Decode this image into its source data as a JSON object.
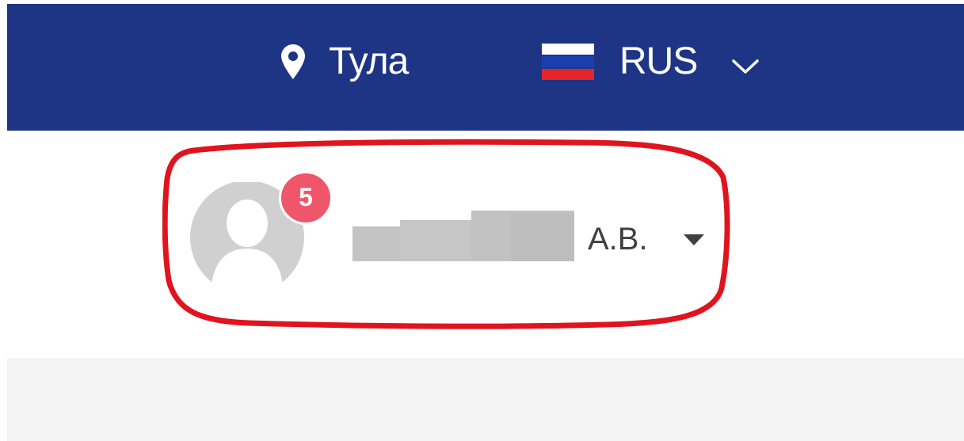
{
  "header": {
    "location": {
      "icon": "map-pin-icon",
      "city": "Тула"
    },
    "language": {
      "flag_icon": "russia-flag-icon",
      "code": "RUS",
      "dropdown_icon": "chevron-down-icon"
    }
  },
  "user_menu": {
    "avatar_icon": "user-avatar-icon",
    "notification_count": "5",
    "name_redacted": true,
    "initials": "А.В.",
    "dropdown_icon": "caret-down-icon",
    "highlight_color": "#e0141e"
  },
  "colors": {
    "header_background": "#1e3585",
    "badge": "#f0566a",
    "avatar": "#d0d0d0",
    "content_background": "#f4f4f4"
  }
}
